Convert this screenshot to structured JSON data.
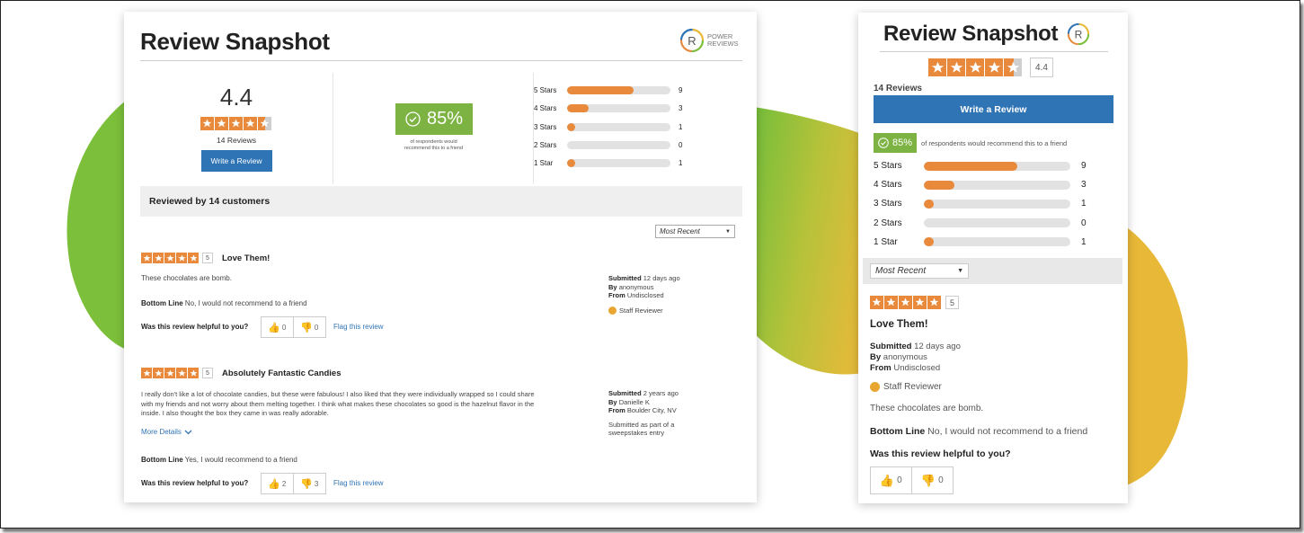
{
  "colors": {
    "accent": "#e8893c",
    "brand_blue": "#2f74b5",
    "recommend_green": "#7cb342",
    "blob_green": "#7cbf3a",
    "blob_yellow": "#e8b838"
  },
  "desktop": {
    "title": "Review Snapshot",
    "brand": {
      "line1": "POWER",
      "line2": "REVIEWS"
    },
    "rating": "4.4",
    "rating_value": 4.4,
    "review_count": "14 Reviews",
    "write_review": "Write a Review",
    "recommend_pct": "85%",
    "recommend_text_1": "of respondents would",
    "recommend_text_2": "recommend this to a friend",
    "histogram": [
      {
        "label": "5 Stars",
        "count": "9",
        "fraction": 0.64
      },
      {
        "label": "4 Stars",
        "count": "3",
        "fraction": 0.21
      },
      {
        "label": "3 Stars",
        "count": "1",
        "fraction": 0.07
      },
      {
        "label": "2 Stars",
        "count": "0",
        "fraction": 0.0
      },
      {
        "label": "1 Star",
        "count": "1",
        "fraction": 0.07
      }
    ],
    "reviewed_by": "Reviewed by 14 customers",
    "sort": "Most Recent",
    "reviews": [
      {
        "stars": "5",
        "headline": "Love Them!",
        "body": [
          "These chocolates are bomb."
        ],
        "submitted_label": "Submitted",
        "submitted": "12 days ago",
        "by_label": "By",
        "by": "anonymous",
        "from_label": "From",
        "from": "Undisclosed",
        "badge": "Staff Reviewer",
        "bottom_line_label": "Bottom Line",
        "bottom_line": "No, I would not recommend to a friend",
        "helpful_q": "Was this review helpful to you?",
        "up": "0",
        "down": "0",
        "flag": "Flag this review"
      },
      {
        "stars": "5",
        "headline": "Absolutely Fantastic Candies",
        "body": [
          "I really don't like a lot of chocolate candies, but these were fabulous! I also liked that they were individually wrapped so I could share",
          "with my friends and not worry about them melting together. I think what makes these chocolates so good is the hazelnut flavor in the",
          "inside. I also thought the box they came in was really adorable."
        ],
        "more": "More Details",
        "submitted_label": "Submitted",
        "submitted": "2 years ago",
        "by_label": "By",
        "by": "Danielle K",
        "from_label": "From",
        "from": "Boulder City, NV",
        "note_1": "Submitted as part of a",
        "note_2": "sweepstakes entry",
        "bottom_line_label": "Bottom Line",
        "bottom_line": "Yes, I would recommend to a friend",
        "helpful_q": "Was this review helpful to you?",
        "up": "2",
        "down": "3",
        "flag": "Flag this review"
      }
    ]
  },
  "mobile": {
    "title": "Review Snapshot",
    "rating": "4.4",
    "rating_value": 4.4,
    "review_count": "14 Reviews",
    "write_review": "Write a Review",
    "recommend_pct": "85%",
    "recommend_text": "of respondents would recommend this to a friend",
    "histogram": [
      {
        "label": "5 Stars",
        "count": "9",
        "fraction": 0.64
      },
      {
        "label": "4 Stars",
        "count": "3",
        "fraction": 0.21
      },
      {
        "label": "3 Stars",
        "count": "1",
        "fraction": 0.07
      },
      {
        "label": "2 Stars",
        "count": "0",
        "fraction": 0.0
      },
      {
        "label": "1 Star",
        "count": "1",
        "fraction": 0.07
      }
    ],
    "sort": "Most Recent",
    "review": {
      "stars": "5",
      "headline": "Love Them!",
      "submitted_label": "Submitted",
      "submitted": "12 days ago",
      "by_label": "By",
      "by": "anonymous",
      "from_label": "From",
      "from": "Undisclosed",
      "badge": "Staff Reviewer",
      "body": "These chocolates are bomb.",
      "bottom_line_label": "Bottom Line",
      "bottom_line": "No, I would not recommend to a friend",
      "helpful_q": "Was this review helpful to you?",
      "up": "0",
      "down": "0"
    }
  }
}
